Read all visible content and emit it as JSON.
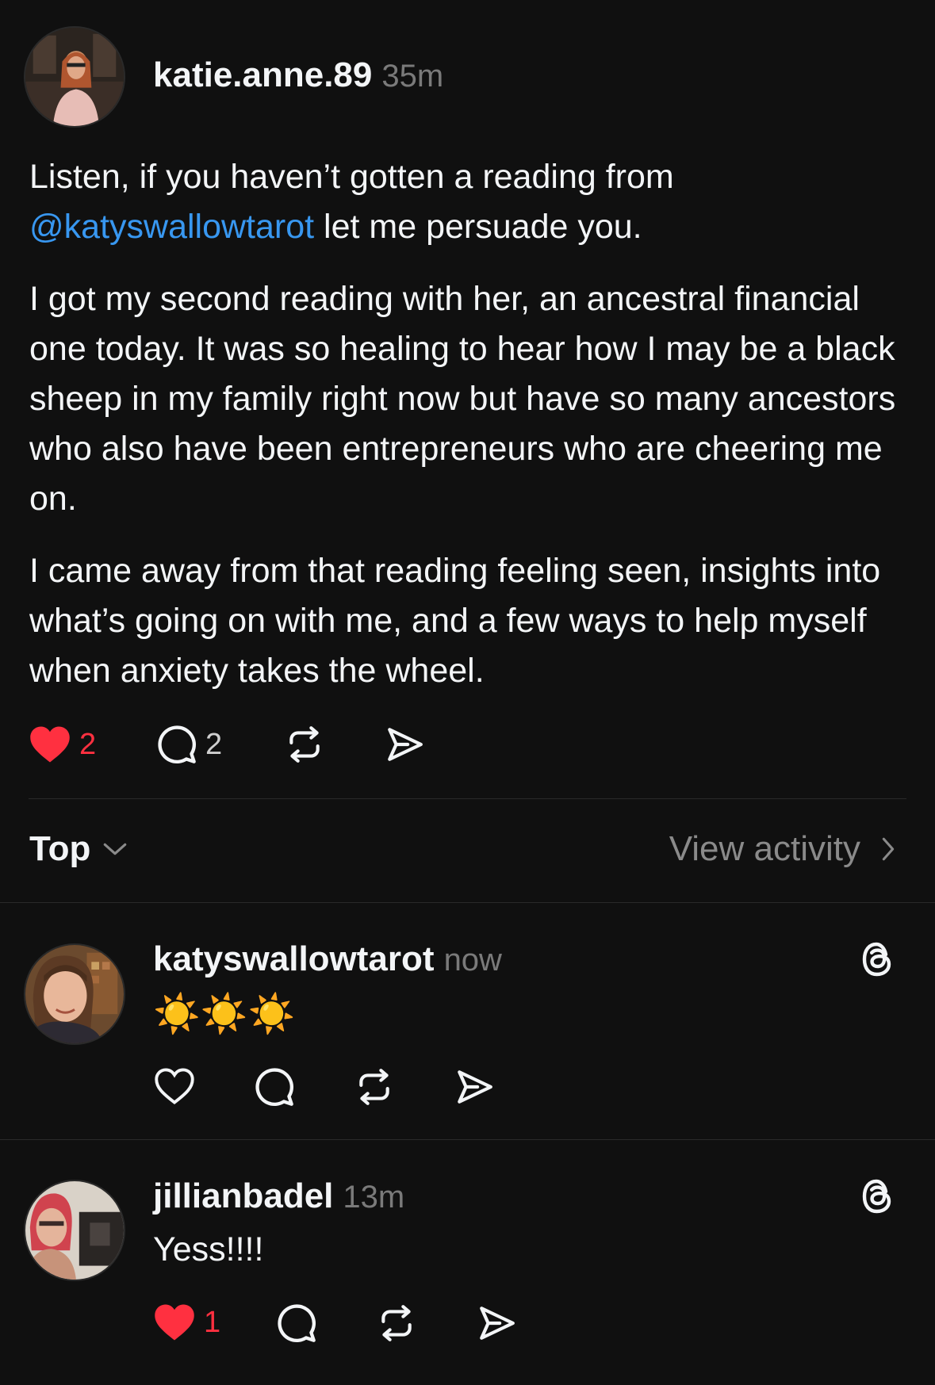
{
  "post": {
    "author": "katie.anne.89",
    "time": "35m",
    "mention": "@katyswallowtarot",
    "line1": "Listen, if you haven’t gotten a reading from",
    "line2_rest": " let me persuade you.",
    "paragraph2": "I got my second reading with her, an ancestral financial one today. It was so healing to hear how I may be a black sheep in my family right now but have so many ancestors who also have been entrepreneurs who are cheering me on.",
    "paragraph3": "I came away from that reading feeling seen, insights into what’s going on with me, and a few ways to help myself when anxiety takes the wheel.",
    "likes": "2",
    "liked": true,
    "comments": "2",
    "icons": [
      "heart-filled-icon",
      "comment-icon",
      "repost-icon",
      "share-icon"
    ]
  },
  "controls": {
    "sort_label": "Top",
    "view_activity_label": "View activity"
  },
  "replies": [
    {
      "author": "katyswallowtarot",
      "time": "now",
      "text": "☀️☀️☀️",
      "liked": false
    },
    {
      "author": "jillianbadel",
      "time": "13m",
      "text": "Yess!!!!",
      "likes": "1",
      "liked": true
    }
  ],
  "colors": {
    "background": "#101010",
    "text": "#f3f5f7",
    "muted": "#7a7a7a",
    "mention": "#3897f0",
    "like": "#ff3040"
  }
}
